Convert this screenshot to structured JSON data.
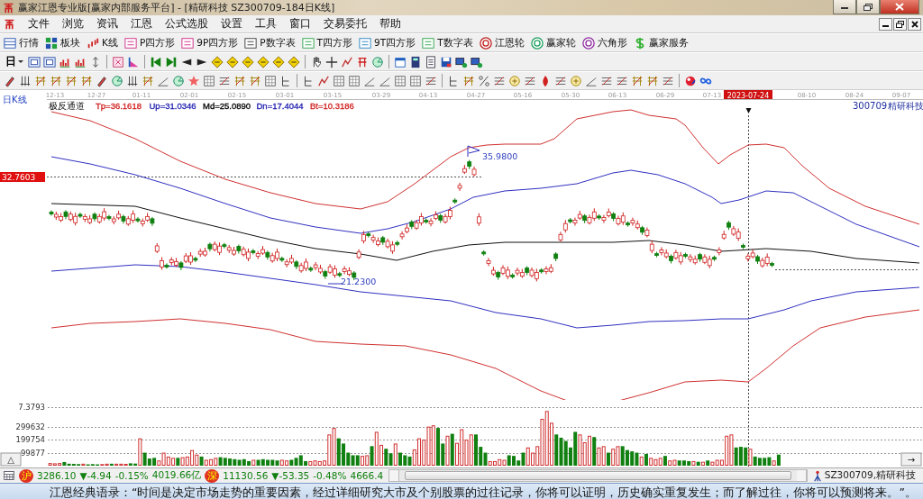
{
  "window": {
    "title": "赢家江恩专业版[赢家内部服务平台] - [精研科技  SZ300709-184日K线]"
  },
  "menu": [
    "文件",
    "浏览",
    "资讯",
    "江恩",
    "公式选股",
    "设置",
    "工具",
    "窗口",
    "交易委托",
    "帮助"
  ],
  "toolbar": [
    {
      "label": "行情"
    },
    {
      "label": "板块"
    },
    {
      "label": "K线"
    },
    {
      "label": "P四方形"
    },
    {
      "label": "9P四方形"
    },
    {
      "label": "P数字表"
    },
    {
      "label": "T四方形"
    },
    {
      "label": "9T四方形"
    },
    {
      "label": "T数字表"
    },
    {
      "label": "江恩轮"
    },
    {
      "label": "赢家轮"
    },
    {
      "label": "六角形"
    },
    {
      "label": "赢家服务"
    }
  ],
  "period_dropdown": {
    "value": "日"
  },
  "chart": {
    "period_label": "日K线",
    "dates": [
      {
        "label": "12-13",
        "kind": "tick"
      },
      {
        "label": "12-27",
        "kind": "tick"
      },
      {
        "label": "01-11",
        "kind": "tick"
      },
      {
        "label": "02-01",
        "kind": "tick"
      },
      {
        "label": "02-15",
        "kind": "tick"
      },
      {
        "label": "03-01",
        "kind": "tick"
      },
      {
        "label": "03-15",
        "kind": "tick"
      },
      {
        "label": "03-29",
        "kind": "tick"
      },
      {
        "label": "04-13",
        "kind": "tick"
      },
      {
        "label": "04-27",
        "kind": "tick"
      },
      {
        "label": "05-16",
        "kind": "tick"
      },
      {
        "label": "05-30",
        "kind": "tick"
      },
      {
        "label": "06-13",
        "kind": "tick"
      },
      {
        "label": "06-29",
        "kind": "tick"
      },
      {
        "label": "07-13",
        "kind": "tick"
      },
      {
        "label": "2023-07-24",
        "kind": "cursor"
      },
      {
        "label": "08-10",
        "kind": "tick"
      },
      {
        "label": "08-24",
        "kind": "tick"
      },
      {
        "label": "09-07",
        "kind": "tick"
      }
    ],
    "indicator": {
      "name": "极反通道",
      "values": [
        {
          "text": "Tp=36.1618",
          "color": "#d02020"
        },
        {
          "text": "Up=31.0346",
          "color": "#2020b0"
        },
        {
          "text": "Md=25.0890",
          "color": "#000000"
        },
        {
          "text": "Dn=17.4044",
          "color": "#2020b0"
        },
        {
          "text": "Bt=10.3186",
          "color": "#d02020"
        }
      ]
    },
    "stock_code": "300709",
    "stock_name": "精研科技",
    "price_tag": "32.7603",
    "high_label": "35.9800",
    "low_label": "21.2300",
    "volume": {
      "top_label": "7.3793",
      "chart_data": {
        "type": "bar",
        "grid": true,
        "ylim": [
          0,
          450000
        ],
        "yticks": [
          99877,
          199754,
          299632
        ],
        "values": [
          20000,
          18000,
          20000,
          28000,
          15000,
          14000,
          12000,
          15000,
          10000,
          12000,
          10000,
          12000,
          15000,
          15000,
          15000,
          15000,
          14000,
          18000,
          16000,
          210000,
          100000,
          55000,
          60000,
          40000,
          100000,
          70000,
          60000,
          60000,
          65000,
          70000,
          120000,
          85000,
          70000,
          45000,
          50000,
          60000,
          65000,
          60000,
          55000,
          50000,
          45000,
          50000,
          35000,
          45000,
          45000,
          50000,
          45000,
          45000,
          40000,
          45000,
          40000,
          45000,
          60000,
          80000,
          35000,
          35000,
          40000,
          35000,
          40000,
          240000,
          290000,
          210000,
          170000,
          100000,
          80000,
          80000,
          75000,
          80000,
          150000,
          260000,
          160000,
          130000,
          95000,
          170000,
          100000,
          80000,
          70000,
          125000,
          210000,
          200000,
          300000,
          310000,
          290000,
          170000,
          230000,
          245000,
          175000,
          280000,
          200000,
          240000,
          240000,
          145000,
          100000,
          35000,
          35000,
          50000,
          45000,
          80000,
          75000,
          40000,
          100000,
          140000,
          100000,
          150000,
          360000,
          420000,
          330000,
          240000,
          215000,
          190000,
          140000,
          260000,
          240000,
          180000,
          230000,
          220000,
          140000,
          150000,
          100000,
          130000,
          150000,
          150000,
          120000,
          110000,
          100000,
          70000,
          90000,
          60000,
          50000,
          60000,
          75000,
          40000,
          45000,
          40000,
          40000,
          35000,
          35000,
          30000,
          30000,
          40000,
          30000,
          45000,
          45000,
          230000,
          240000,
          140000,
          145000,
          140000,
          130000,
          70000,
          60000,
          60000,
          65000,
          40000,
          85000,
          null,
          null,
          null,
          null,
          null,
          null,
          null,
          null,
          null,
          null,
          null,
          null,
          null,
          null,
          null,
          null,
          null,
          null,
          null,
          null,
          null,
          null,
          null,
          null,
          null,
          null,
          null,
          null,
          null,
          null
        ]
      },
      "rising": [
        true,
        true,
        true,
        false,
        false,
        false,
        false,
        true,
        false,
        false,
        false,
        true,
        true,
        false,
        true,
        true,
        true,
        false,
        false,
        true,
        false,
        false,
        false,
        true,
        true,
        true,
        true,
        false,
        true,
        true,
        true,
        true,
        false,
        true,
        true,
        true,
        false,
        false,
        false,
        false,
        false,
        false,
        false,
        true,
        false,
        false,
        false,
        false,
        false,
        true,
        true,
        false,
        false,
        false,
        false,
        true,
        true,
        true,
        true,
        true,
        true,
        false,
        false,
        false,
        false,
        false,
        true,
        true,
        false,
        true,
        true,
        false,
        false,
        true,
        false,
        false,
        false,
        true,
        true,
        true,
        true,
        true,
        false,
        false,
        true,
        false,
        true,
        true,
        true,
        true,
        false,
        false,
        false,
        true,
        true,
        true,
        true,
        false,
        false,
        false,
        false,
        true,
        true,
        true,
        true,
        true,
        true,
        false,
        false,
        false,
        false,
        false,
        true,
        true,
        true,
        false,
        true,
        true,
        false,
        true,
        true,
        false,
        false,
        false,
        false,
        true,
        false,
        true,
        true,
        true,
        false,
        true,
        true,
        false,
        false,
        false,
        true,
        false,
        true,
        false,
        true,
        true,
        true,
        true,
        true,
        false,
        false,
        false,
        true,
        false,
        false,
        false,
        false,
        true,
        false
      ],
      "collapse_button": "△",
      "scroll_button": "→"
    }
  },
  "status_bar": {
    "sh_badge": "沪",
    "sh_index": "3286.10",
    "sh_change": "▼-4.94",
    "sh_percent": "-0.15%",
    "sh_amount": "4019.66亿",
    "sz_badge": "深",
    "sz_index": "11130.56",
    "sz_change": "▼-53.35",
    "sz_percent": "-0.48%",
    "sz_amount": "4666.4",
    "security": "SZ300709,精研科技"
  },
  "quote": "江恩经典语录：“时间是决定市场走势的重要因素，经过详细研究大市及个别股票的过往记录，你将可以证明，历史确实重复发生；而了解过往，你将可以预测将来。”。"
}
